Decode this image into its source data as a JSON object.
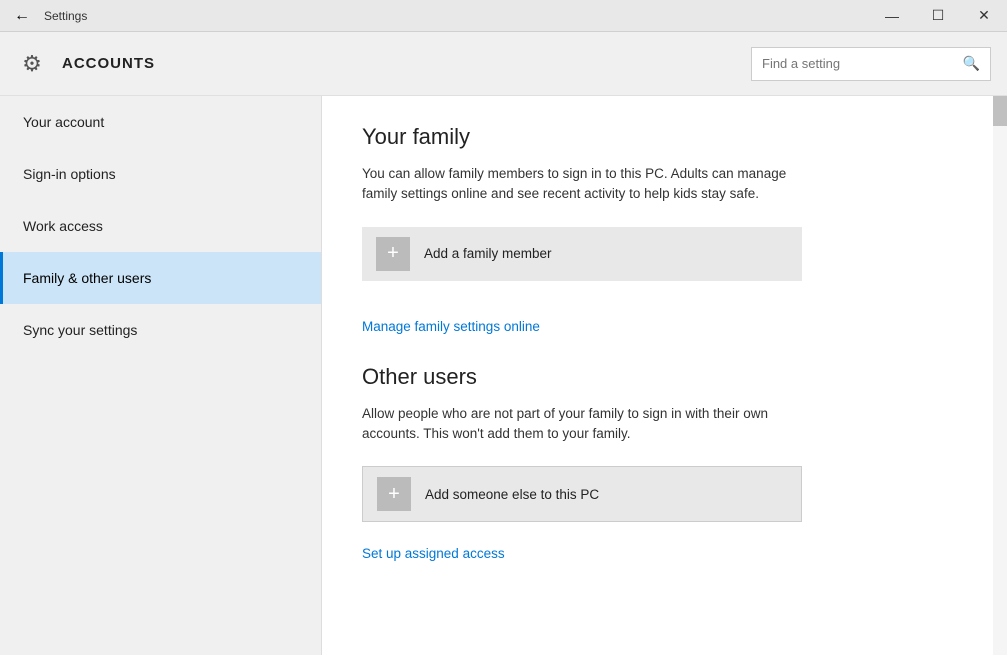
{
  "titlebar": {
    "title": "Settings",
    "back_label": "←",
    "minimize_label": "—",
    "maximize_label": "☐",
    "close_label": "✕"
  },
  "header": {
    "title": "ACCOUNTS",
    "search_placeholder": "Find a setting"
  },
  "sidebar": {
    "items": [
      {
        "id": "your-account",
        "label": "Your account",
        "active": false
      },
      {
        "id": "sign-in-options",
        "label": "Sign-in options",
        "active": false
      },
      {
        "id": "work-access",
        "label": "Work access",
        "active": false
      },
      {
        "id": "family-other-users",
        "label": "Family & other users",
        "active": true
      },
      {
        "id": "sync-settings",
        "label": "Sync your settings",
        "active": false
      }
    ]
  },
  "content": {
    "family_section": {
      "title": "Your family",
      "description": "You can allow family members to sign in to this PC. Adults can manage family settings online and see recent activity to help kids stay safe.",
      "add_button_label": "Add a family member",
      "manage_link": "Manage family settings online"
    },
    "other_users_section": {
      "title": "Other users",
      "description": "Allow people who are not part of your family to sign in with their own accounts. This won't add them to your family.",
      "add_button_label": "Add someone else to this PC",
      "setup_link": "Set up assigned access"
    }
  }
}
